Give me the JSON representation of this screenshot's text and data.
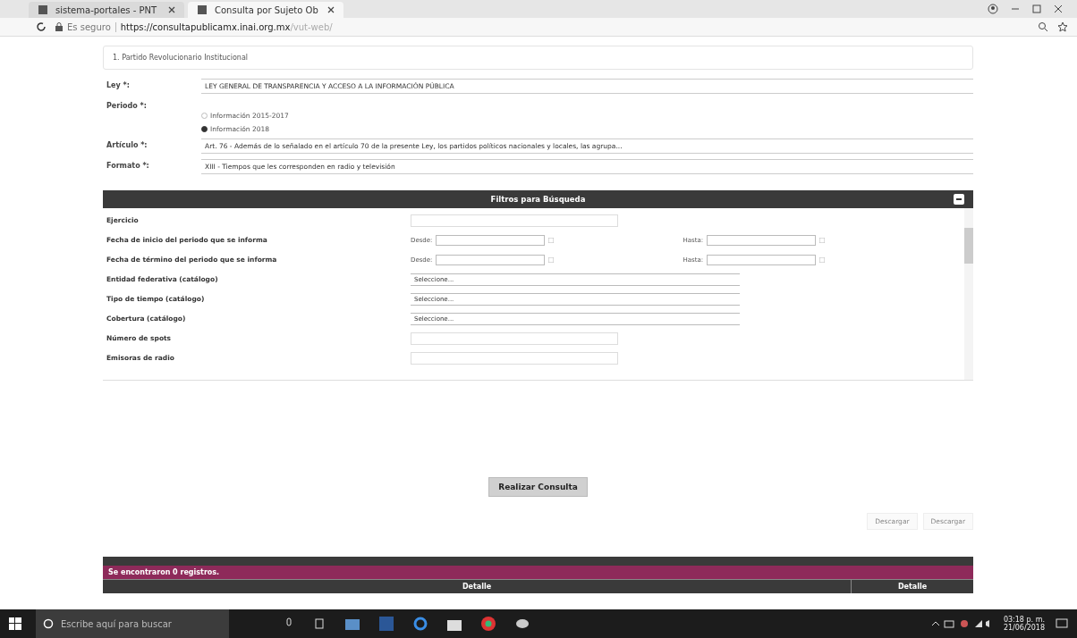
{
  "browser": {
    "tabs": [
      {
        "title": "sistema-portales - PNT",
        "selected": false
      },
      {
        "title": "Consulta por Sujeto Ob",
        "selected": true
      }
    ],
    "security": "Es seguro",
    "url_host": "https://consultapublicamx.inai.org.mx",
    "url_path": "/vut-web/"
  },
  "subject": "1. Partido Revolucionario Institucional",
  "form": [
    {
      "kind": "select",
      "label": "Ley *:",
      "value": "LEY GENERAL DE TRANSPARENCIA Y ACCESO A LA INFORMACIÓN PÚBLICA"
    },
    {
      "kind": "radio",
      "label": "Periodo *:",
      "options": [
        {
          "label": "Información 2015-2017",
          "selected": false
        },
        {
          "label": "Información 2018",
          "selected": true
        }
      ]
    },
    {
      "kind": "select",
      "label": "Artículo *:",
      "value": "Art. 76 - Además de lo señalado en el artículo 70 de la presente Ley, los partidos políticos nacionales y locales, las agrupa..."
    },
    {
      "kind": "select",
      "label": "Formato *:",
      "value": "XIII - Tiempos que les corresponden en radio y televisión"
    }
  ],
  "filters": {
    "title": "Filtros para Búsqueda",
    "rows": [
      {
        "kind": "text",
        "label": "Ejercicio"
      },
      {
        "kind": "range",
        "label": "Fecha de inicio del periodo que se informa",
        "from": "Desde:",
        "to": "Hasta:"
      },
      {
        "kind": "range",
        "label": "Fecha de término del periodo que se informa",
        "from": "Desde:",
        "to": "Hasta:"
      },
      {
        "kind": "select",
        "label": "Entidad federativa (catálogo)",
        "value": "Seleccione..."
      },
      {
        "kind": "select",
        "label": "Tipo de tiempo (catálogo)",
        "value": "Seleccione..."
      },
      {
        "kind": "select",
        "label": "Cobertura (catálogo)",
        "value": "Seleccione..."
      },
      {
        "kind": "text",
        "label": "Número de spots"
      },
      {
        "kind": "text",
        "label": "Emisoras de radio"
      }
    ]
  },
  "submit": "Realizar Consulta",
  "downloads": [
    "Descargar",
    "Descargar"
  ],
  "results": {
    "message": "Se encontraron 0 registros.",
    "columns": [
      "Detalle",
      "Detalle"
    ]
  },
  "taskbar": {
    "search_placeholder": "Escribe aquí para buscar",
    "time": "03:18 p. m.",
    "date": "21/06/2018"
  }
}
